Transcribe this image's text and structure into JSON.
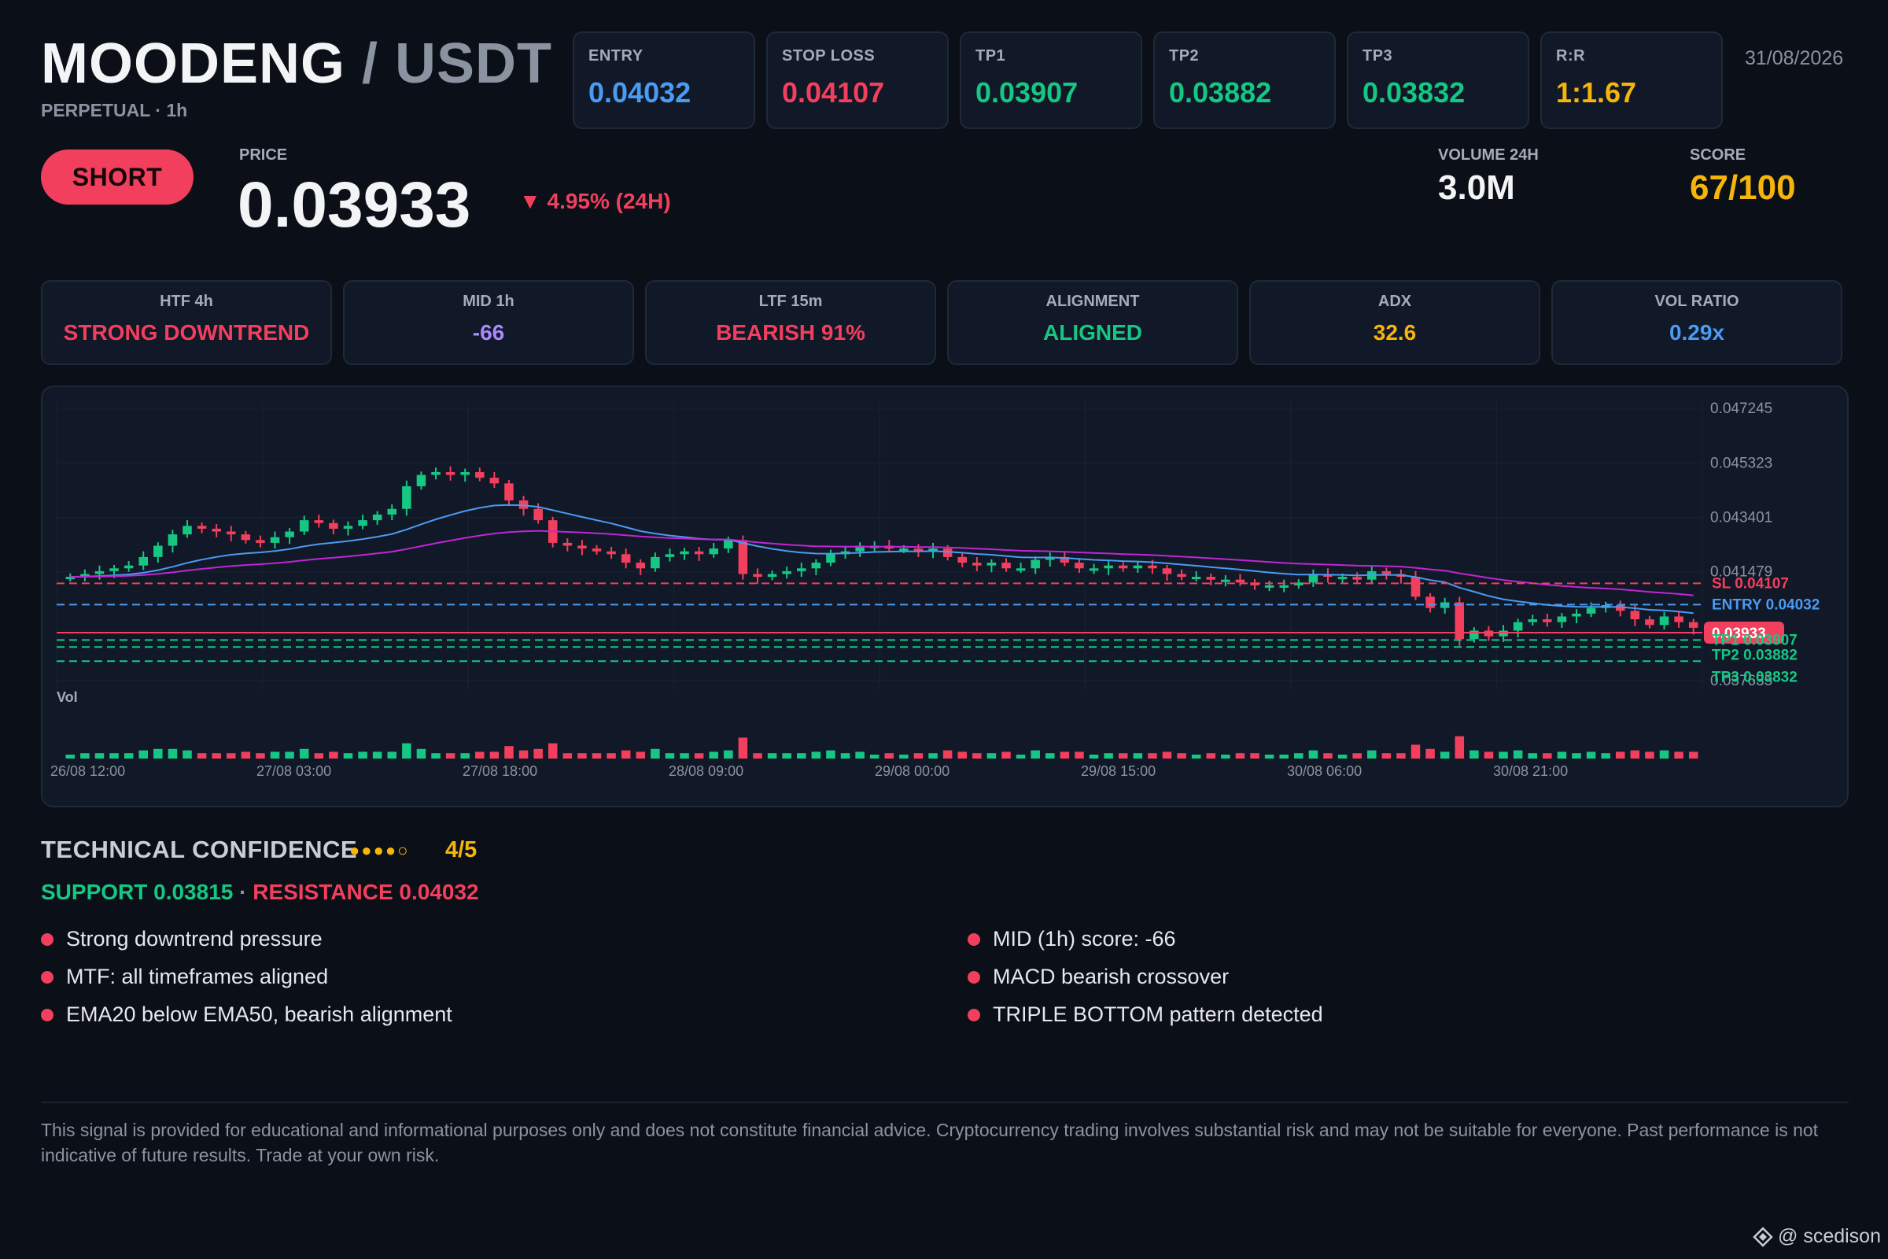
{
  "header": {
    "base": "MOODENG",
    "separator": " / ",
    "quote": "USDT",
    "subtitle": "PERPETUAL · 1h",
    "date": "31/08/2026"
  },
  "levels": [
    {
      "label": "ENTRY",
      "value": "0.04032",
      "color": "#4a9bf2"
    },
    {
      "label": "STOP LOSS",
      "value": "0.04107",
      "color": "#f23f5d"
    },
    {
      "label": "TP1",
      "value": "0.03907",
      "color": "#16c784"
    },
    {
      "label": "TP2",
      "value": "0.03882",
      "color": "#16c784"
    },
    {
      "label": "TP3",
      "value": "0.03832",
      "color": "#16c784"
    },
    {
      "label": "R:R",
      "value": "1:1.67",
      "color": "#f5b50a"
    }
  ],
  "signal": {
    "direction": "SHORT",
    "price_label": "PRICE",
    "price": "0.03933",
    "change": "▼ 4.95% (24H)",
    "volume_label": "VOLUME 24H",
    "volume": "3.0M",
    "score_label": "SCORE",
    "score": "67/100"
  },
  "timeframes": [
    {
      "label": "HTF 4h",
      "value": "STRONG DOWNTREND",
      "color": "#f23f5d"
    },
    {
      "label": "MID 1h",
      "value": "-66",
      "color": "#a78bfa"
    },
    {
      "label": "LTF 15m",
      "value": "BEARISH 91%",
      "color": "#f23f5d"
    },
    {
      "label": "ALIGNMENT",
      "value": "ALIGNED",
      "color": "#16c784"
    },
    {
      "label": "ADX",
      "value": "32.6",
      "color": "#f5b50a"
    },
    {
      "label": "VOL RATIO",
      "value": "0.29x",
      "color": "#4a9bf2"
    }
  ],
  "chart_data": {
    "type": "candlestick",
    "interval": "1h",
    "y_axis_ticks": [
      "0.047245",
      "0.045323",
      "0.043401",
      "0.041479",
      "0.037635"
    ],
    "ylim": [
      0.0373,
      0.0475
    ],
    "x_axis_ticks": [
      "26/08 12:00",
      "27/08 03:00",
      "27/08 18:00",
      "28/08 09:00",
      "29/08 00:00",
      "29/08 15:00",
      "30/08 06:00",
      "30/08 21:00"
    ],
    "close_series": [
      0.0413,
      0.0414,
      0.0415,
      0.0416,
      0.0417,
      0.042,
      0.0424,
      0.0428,
      0.0431,
      0.043,
      0.0429,
      0.0428,
      0.0426,
      0.0425,
      0.0427,
      0.0429,
      0.0433,
      0.0432,
      0.043,
      0.0431,
      0.0433,
      0.0435,
      0.0437,
      0.0445,
      0.0449,
      0.045,
      0.0449,
      0.045,
      0.0448,
      0.0446,
      0.044,
      0.0437,
      0.0433,
      0.0425,
      0.0424,
      0.0423,
      0.0422,
      0.0421,
      0.0418,
      0.0416,
      0.042,
      0.0421,
      0.0422,
      0.0421,
      0.0423,
      0.0426,
      0.0414,
      0.0413,
      0.0414,
      0.0415,
      0.0416,
      0.0418,
      0.0421,
      0.0422,
      0.0424,
      0.0424,
      0.0423,
      0.0423,
      0.0422,
      0.0423,
      0.042,
      0.0418,
      0.0417,
      0.0418,
      0.0416,
      0.0416,
      0.0419,
      0.042,
      0.0418,
      0.0416,
      0.0416,
      0.0417,
      0.0416,
      0.0417,
      0.0416,
      0.0414,
      0.0413,
      0.0413,
      0.0412,
      0.0412,
      0.0411,
      0.041,
      0.041,
      0.041,
      0.0411,
      0.0414,
      0.0413,
      0.0413,
      0.0412,
      0.0415,
      0.0414,
      0.0413,
      0.0406,
      0.0402,
      0.0404,
      0.0391,
      0.0394,
      0.0392,
      0.0394,
      0.0397,
      0.0398,
      0.0397,
      0.0399,
      0.04,
      0.0402,
      0.0403,
      0.0401,
      0.0398,
      0.0396,
      0.0399,
      0.0397,
      0.0395
    ],
    "series": [
      {
        "name": "EMA20",
        "color": "#4a9bf2"
      },
      {
        "name": "EMA50",
        "color": "#c026d3"
      }
    ],
    "price_lines": [
      {
        "label": "SL 0.04107",
        "value": 0.04107,
        "color": "#f23f5d"
      },
      {
        "label": "ENTRY 0.04032",
        "value": 0.04032,
        "color": "#4a9bf2"
      },
      {
        "label": "0.03933",
        "value": 0.03933,
        "color": "#f23f5d"
      },
      {
        "label": "TP1 0.03907",
        "value": 0.03907,
        "color": "#16c784"
      },
      {
        "label": "TP2 0.03882",
        "value": 0.03882,
        "color": "#16c784"
      },
      {
        "label": "TP3 0.03832",
        "value": 0.03832,
        "color": "#16c784"
      }
    ],
    "volume_label": "Vol"
  },
  "confidence": {
    "title": "TECHNICAL CONFIDENCE",
    "dots": "●●●●○",
    "score": "4/5",
    "support": "SUPPORT 0.03815",
    "divider": " · ",
    "resistance": "RESISTANCE 0.04032",
    "reasons_left": [
      "Strong downtrend pressure",
      "MTF: all timeframes aligned",
      "EMA20 below EMA50, bearish alignment"
    ],
    "reasons_right": [
      "MID (1h) score: -66",
      "MACD bearish crossover",
      "TRIPLE BOTTOM pattern detected"
    ]
  },
  "disclaimer": "This signal is provided for educational and informational purposes only and does not constitute financial advice. Cryptocurrency trading involves substantial risk and may not be suitable for everyone. Past performance is not indicative of future results. Trade at your own risk.",
  "credit": "@ scedison"
}
